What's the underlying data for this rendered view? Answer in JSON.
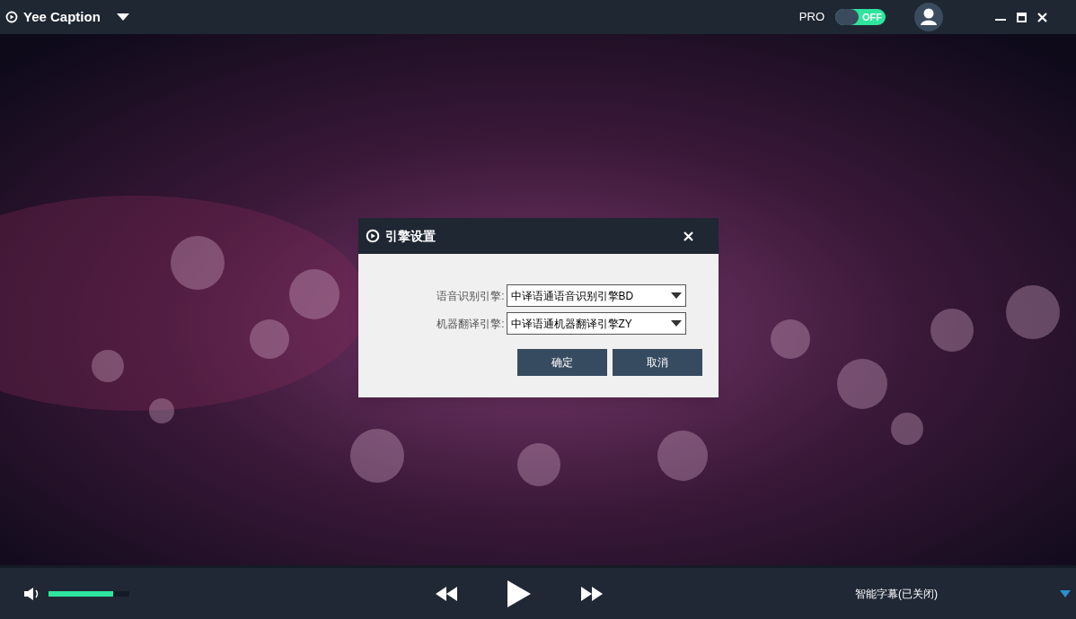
{
  "app": {
    "title": "Yee Caption"
  },
  "pro": {
    "label": "PRO",
    "toggle": {
      "on": false,
      "text": "OFF"
    }
  },
  "dialog": {
    "title": "引擎设置",
    "fields": [
      {
        "label": "语音识别引擎:",
        "value": "中译语通语音识别引擎BD"
      },
      {
        "label": "机器翻译引擎:",
        "value": "中译语通机器翻译引擎ZY"
      }
    ],
    "buttons": [
      "确定",
      "取消"
    ]
  },
  "player": {
    "volume": {
      "level": 0.8
    },
    "subtitle_status": "智能字幕(已关闭)"
  }
}
